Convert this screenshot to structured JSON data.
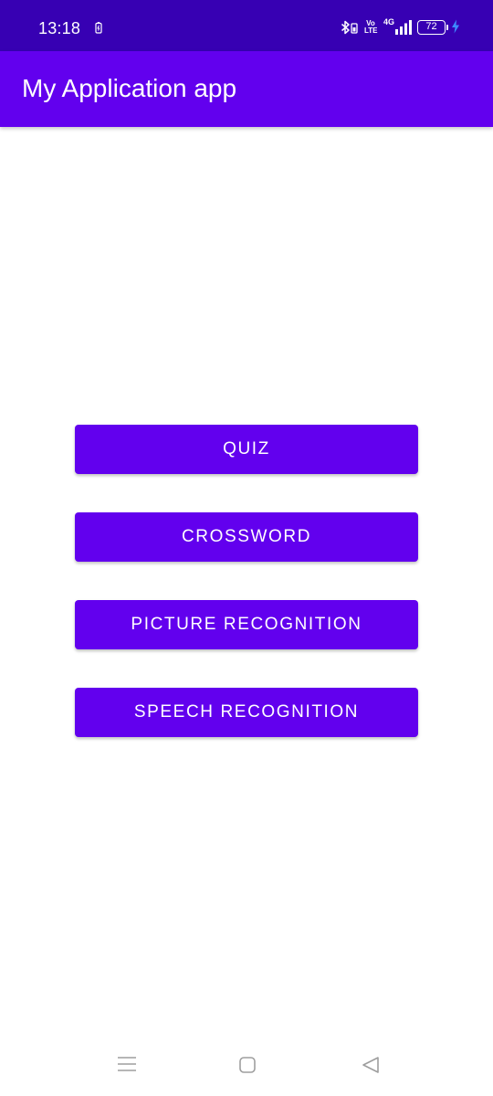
{
  "status_bar": {
    "time": "13:18",
    "network_type": "4G",
    "volte_label": "Vo LTE",
    "battery_level": "72",
    "icons": [
      "battery-saver-icon",
      "bluetooth-icon",
      "volte-icon",
      "signal-icon",
      "battery-icon",
      "charging-icon"
    ],
    "background_color": "#3700b3"
  },
  "app_bar": {
    "title": "My Application app",
    "background_color": "#6200ee"
  },
  "main": {
    "buttons": [
      {
        "label": "QUIZ"
      },
      {
        "label": "CROSSWORD"
      },
      {
        "label": "PICTURE RECOGNITION"
      },
      {
        "label": "SPEECH RECOGNITION"
      }
    ],
    "button_color": "#6200ee"
  },
  "navigation_bar": {
    "buttons": [
      "menu-icon",
      "home-icon",
      "back-icon"
    ]
  }
}
